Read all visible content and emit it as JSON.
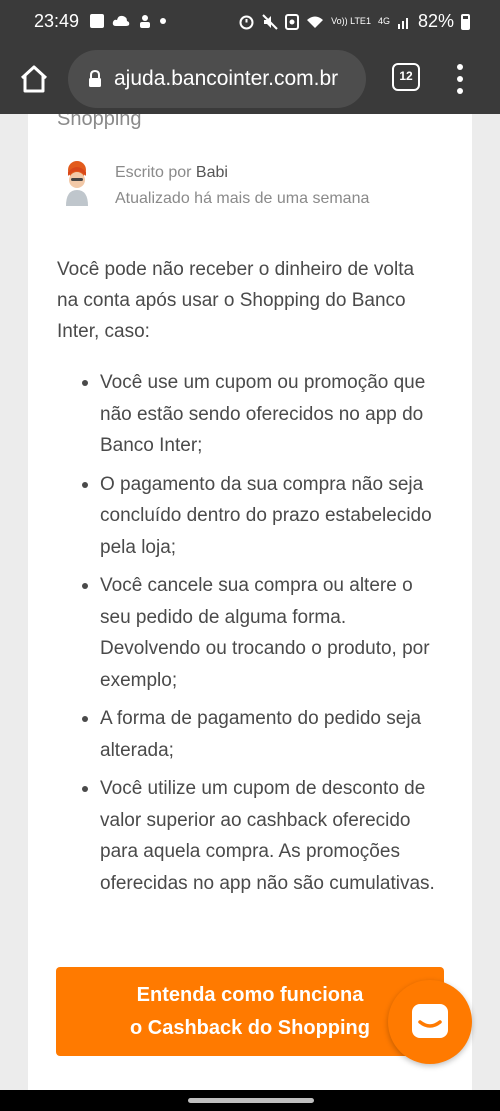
{
  "status_bar": {
    "time": "23:49",
    "network_label": "Vo)) LTE1",
    "signal_label": "4G",
    "battery": "82%"
  },
  "browser": {
    "url": "ajuda.bancointer.com.br",
    "tab_count": "12",
    "toolbar_color": "#3a3a3a"
  },
  "article": {
    "category": "Shopping",
    "author_prefix": "Escrito por",
    "author_name": "Babi",
    "updated": "Atualizado há mais de uma semana",
    "intro": "Você pode não receber o dinheiro de volta na conta após usar o Shopping do Banco Inter, caso:",
    "reasons": [
      "Você use um cupom ou promoção que não estão sendo oferecidos no app do Banco Inter;",
      "O pagamento da sua compra não seja concluído dentro do prazo estabelecido pela loja;",
      "Você cancele sua compra ou altere o seu pedido de alguma forma. Devolvendo ou trocando o produto, por exemplo;",
      "A forma de pagamento do pedido seja alterada;",
      "Você utilize um cupom de desconto de valor superior ao cashback oferecido para aquela compra. As promoções oferecidas no app não são cumulativas."
    ],
    "cta_line1": "Entenda como funciona",
    "cta_line2": "o Cashback do Shopping"
  },
  "colors": {
    "accent": "#ff7a00",
    "text": "#4a4a4a",
    "muted": "#8a8a8a"
  },
  "icons": {
    "home": "home-icon",
    "lock": "lock-icon",
    "tabs": "tabs-icon",
    "menu": "more-vert-icon",
    "chat": "chat-icon"
  }
}
